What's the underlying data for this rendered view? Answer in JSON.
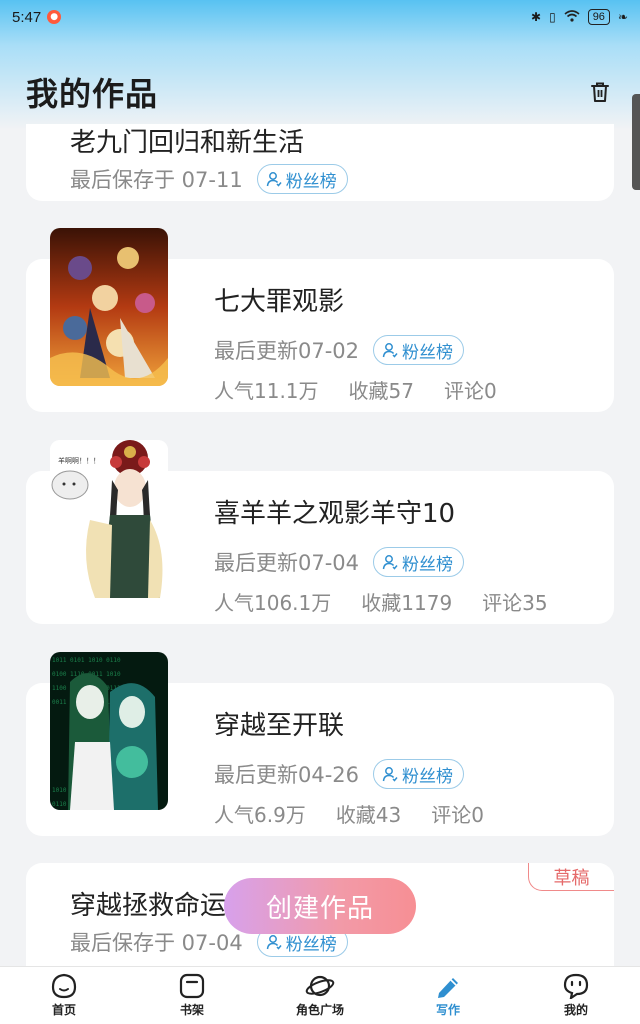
{
  "status_bar": {
    "time": "5:47",
    "battery": "96"
  },
  "header": {
    "title": "我的作品"
  },
  "works": [
    {
      "name": "老九门回归和新生活",
      "meta": "最后保存于 07-11",
      "fans": "粉丝榜"
    },
    {
      "name": "七大罪观影",
      "meta": "最后更新07-02",
      "fans": "粉丝榜",
      "popularity": "人气11.1万",
      "favorites": "收藏57",
      "comments": "评论0"
    },
    {
      "name": "喜羊羊之观影羊守10",
      "meta": "最后更新07-04",
      "fans": "粉丝榜",
      "popularity": "人气106.1万",
      "favorites": "收藏1179",
      "comments": "评论35",
      "cover_text": "羊啊啊！！！"
    },
    {
      "name": "穿越至开联",
      "meta": "最后更新04-26",
      "fans": "粉丝榜",
      "popularity": "人气6.9万",
      "favorites": "收藏43",
      "comments": "评论0"
    },
    {
      "name": "穿越拯救命运",
      "meta": "最后保存于 07-04",
      "fans": "粉丝榜",
      "badge": "草稿"
    }
  ],
  "create_button": "创建作品",
  "nav": [
    {
      "label": "首页",
      "icon": "home-icon"
    },
    {
      "label": "书架",
      "icon": "bookshelf-icon"
    },
    {
      "label": "角色广场",
      "icon": "planet-icon"
    },
    {
      "label": "写作",
      "icon": "pen-icon"
    },
    {
      "label": "我的",
      "icon": "profile-icon"
    }
  ],
  "colors": {
    "accent": "#2f8fd0",
    "draft": "#e56a6a",
    "background": "#f2f3f5"
  }
}
